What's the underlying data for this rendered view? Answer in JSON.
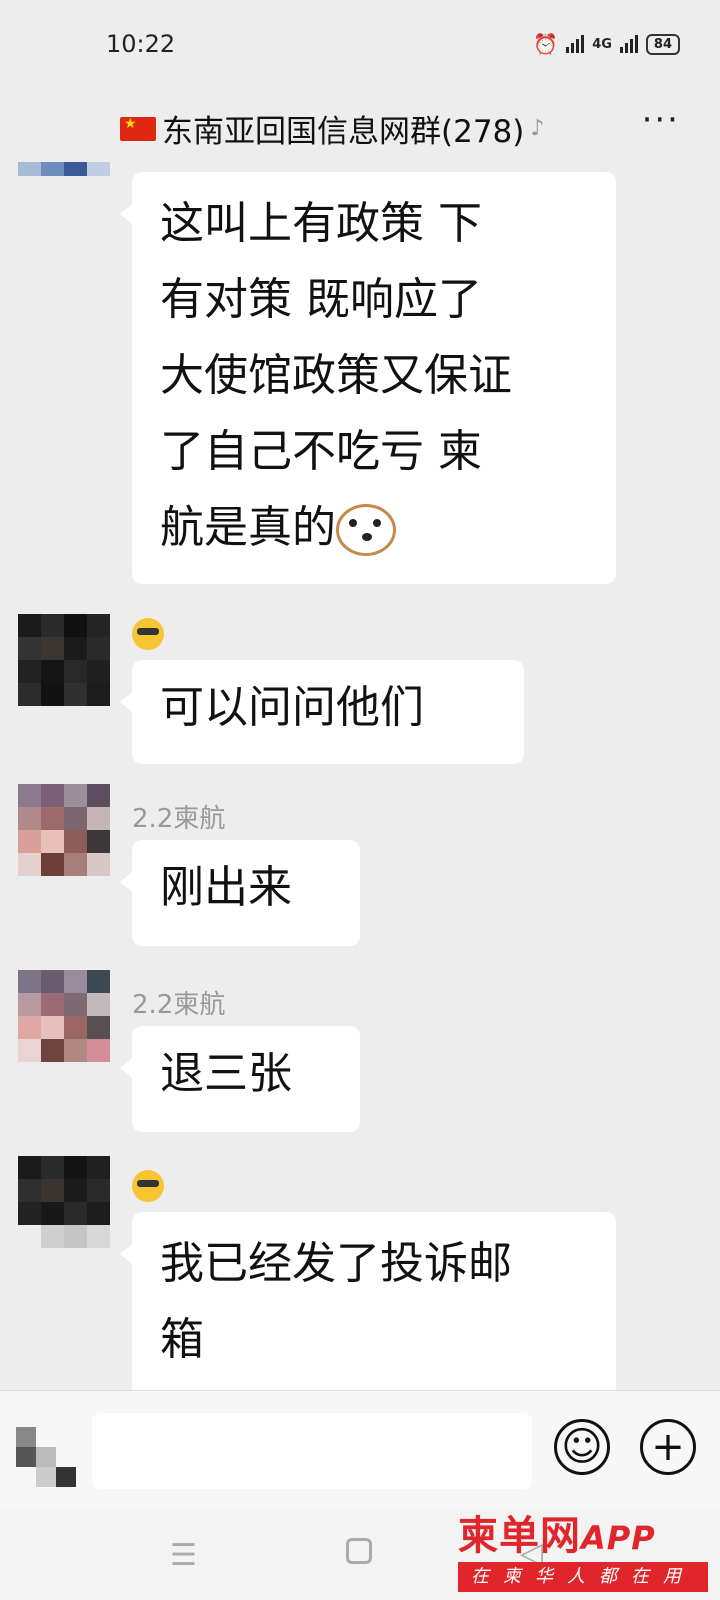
{
  "status_bar": {
    "time": "10:22",
    "network": "4G",
    "battery": "84"
  },
  "header": {
    "title": "东南亚回国信息网群(278)",
    "mute_glyph": "♪",
    "more_glyph": "···"
  },
  "messages": [
    {
      "sender": "",
      "lines": [
        "这叫上有政策 下",
        "有对策 既响应了",
        "大使馆政策又保证",
        "了自己不吃亏 柬",
        "航是真的"
      ],
      "has_dog_emoji": true
    },
    {
      "sender": "",
      "lines": [
        "可以问问他们"
      ],
      "sender_emoji": "sunglasses"
    },
    {
      "sender": "2.2柬航",
      "lines": [
        "刚出来"
      ]
    },
    {
      "sender": "2.2柬航",
      "lines": [
        "退三张"
      ]
    },
    {
      "sender": "",
      "lines": [
        "我已经发了投诉邮",
        "箱"
      ],
      "sender_emoji": "sunglasses"
    }
  ],
  "input_bar": {
    "emoji_button": "☺",
    "plus_button": "+"
  },
  "nav": {
    "menu_glyph": "☰",
    "back_glyph": "◁"
  },
  "watermark": {
    "logo": "柬单网",
    "logo_suffix": "APP",
    "tagline": "在柬华人都在用"
  },
  "colors": {
    "background": "#ededed",
    "bubble": "#ffffff",
    "watermark_red": "#e0262a"
  }
}
